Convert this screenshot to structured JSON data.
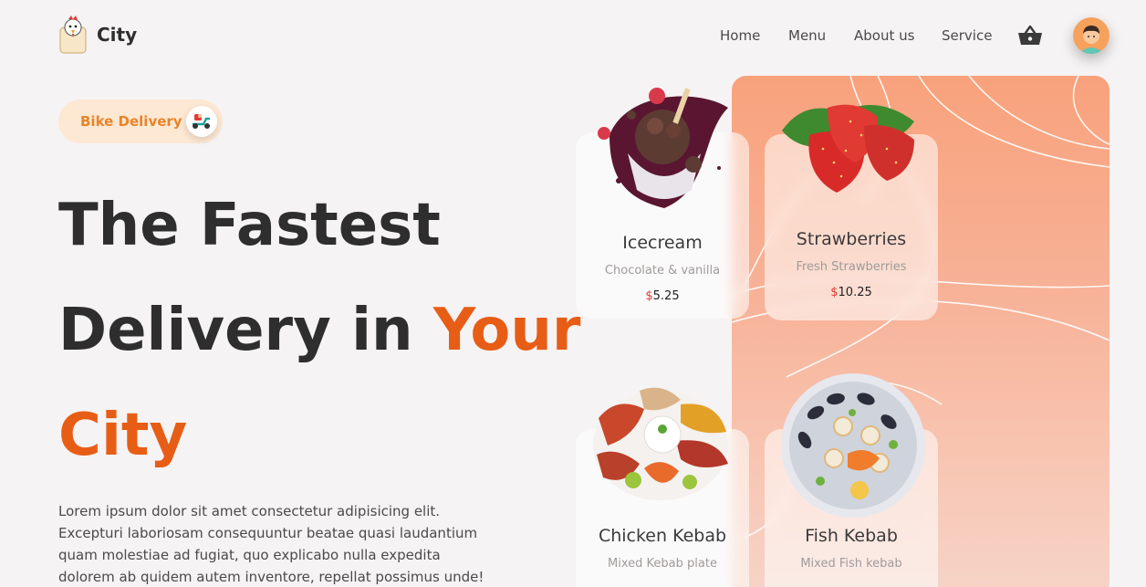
{
  "header": {
    "logo_text": "City",
    "nav": [
      "Home",
      "Menu",
      "About us",
      "Service"
    ]
  },
  "hero": {
    "badge_label": "Bike Delivery",
    "title_line1": "The Fastest",
    "title_line2": "Delivery in",
    "title_accent1": "Your",
    "title_accent2": "City",
    "description": "Lorem ipsum dolor sit amet consectetur adipisicing elit. Excepturi laboriosam consequuntur beatae quasi laudantium quam molestiae ad fugiat, quo explicabo nulla expedita dolorem ab quidem autem inventore, repellat possimus unde!"
  },
  "cards": [
    {
      "name": "Icecream",
      "desc": "Chocolate & vanilla",
      "currency": "$",
      "price": "5.25"
    },
    {
      "name": "Strawberries",
      "desc": "Fresh Strawberries",
      "currency": "$",
      "price": "10.25"
    },
    {
      "name": "Chicken Kebab",
      "desc": "Mixed Kebab plate"
    },
    {
      "name": "Fish Kebab",
      "desc": "Mixed Fish kebab"
    }
  ],
  "colors": {
    "accent": "#e85d15",
    "badge_bg": "#fde8d3",
    "badge_text": "#e8842b",
    "panel_top": "#f8a27c",
    "price_currency": "#e53935"
  },
  "icons": [
    "chicken-logo-icon",
    "basket-icon",
    "avatar-icon",
    "scooter-icon"
  ]
}
